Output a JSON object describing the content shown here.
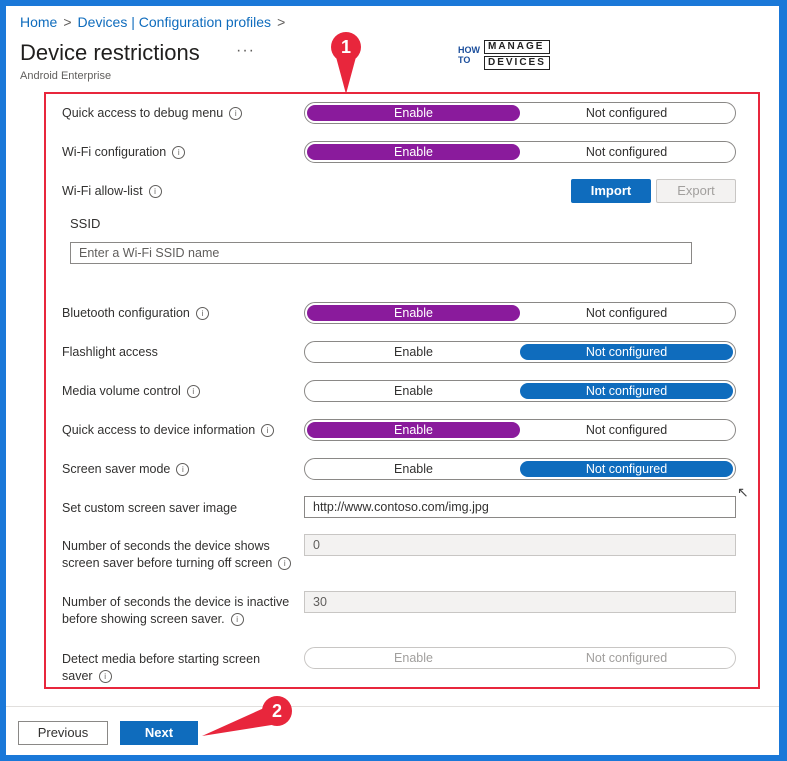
{
  "breadcrumb": {
    "home": "Home",
    "sep": ">",
    "section": "Devices | Configuration profiles"
  },
  "header": {
    "title": "Device restrictions",
    "ellipsis": "···",
    "subtitle": "Android Enterprise"
  },
  "logo": {
    "how": "HOW",
    "to": "TO",
    "word1": "MANAGE",
    "word2": "DEVICES"
  },
  "settings": {
    "debug_menu": {
      "label": "Quick access to debug menu",
      "on": "Enable",
      "off": "Not configured"
    },
    "wifi_config": {
      "label": "Wi-Fi configuration",
      "on": "Enable",
      "off": "Not configured"
    },
    "wifi_allow": {
      "label": "Wi-Fi allow-list",
      "import": "Import",
      "export": "Export",
      "ssid_label": "SSID",
      "ssid_placeholder": "Enter a Wi-Fi SSID name"
    },
    "bluetooth": {
      "label": "Bluetooth configuration",
      "on": "Enable",
      "off": "Not configured"
    },
    "flashlight": {
      "label": "Flashlight access",
      "on": "Enable",
      "off": "Not configured"
    },
    "media_volume": {
      "label": "Media volume control",
      "on": "Enable",
      "off": "Not configured"
    },
    "device_info": {
      "label": "Quick access to device information",
      "on": "Enable",
      "off": "Not configured"
    },
    "screen_saver": {
      "label": "Screen saver mode",
      "on": "Enable",
      "off": "Not configured"
    },
    "custom_image": {
      "label": "Set custom screen saver image",
      "value": "http://www.contoso.com/img.jpg"
    },
    "seconds_show": {
      "label_line1": "Number of seconds the device shows",
      "label_line2": "screen saver before turning off screen",
      "value": "0"
    },
    "seconds_inactive": {
      "label_line1": "Number of seconds the device is inactive",
      "label_line2": "before showing screen saver.",
      "value": "30"
    },
    "detect_media": {
      "label_line1": "Detect media before starting screen",
      "label_line2": "saver",
      "on": "Enable",
      "off": "Not configured"
    }
  },
  "footer": {
    "previous": "Previous",
    "next": "Next"
  },
  "callouts": {
    "one": "1",
    "two": "2"
  },
  "colors": {
    "accent_blue": "#0f6cbd",
    "accent_purple": "#8a1b9c",
    "highlight_red": "#e8263c",
    "border_blue": "#1a78d8"
  }
}
